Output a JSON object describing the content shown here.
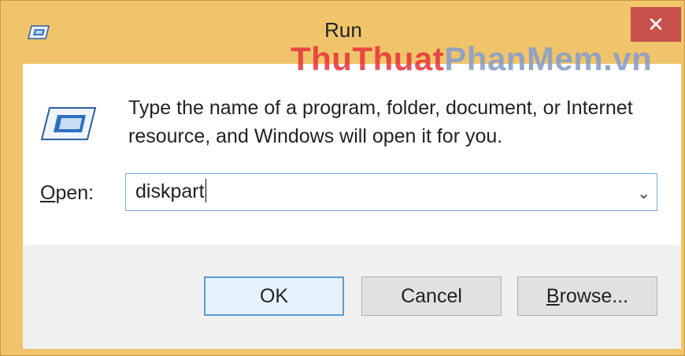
{
  "window": {
    "title": "Run",
    "close_symbol": "✕",
    "colors": {
      "frame": "#f0c46a",
      "close": "#c7504a",
      "focus": "#5b9bd5"
    }
  },
  "watermark": {
    "part1": "ThuThuat",
    "part2": "PhanMem",
    "part3": ".vn"
  },
  "content": {
    "description_line1": "Type the name of a program, folder, document, or Internet",
    "description_line2": "resource, and Windows will open it for you.",
    "open_label_accel": "O",
    "open_label_rest": "pen:",
    "open_value": "diskpart",
    "dropdown_symbol": "⌄"
  },
  "buttons": {
    "ok": "OK",
    "cancel": "Cancel",
    "browse_accel": "B",
    "browse_rest": "rowse..."
  },
  "icons": {
    "title": "run-icon",
    "big": "run-icon",
    "close": "close-icon",
    "dropdown": "chevron-down-icon"
  }
}
